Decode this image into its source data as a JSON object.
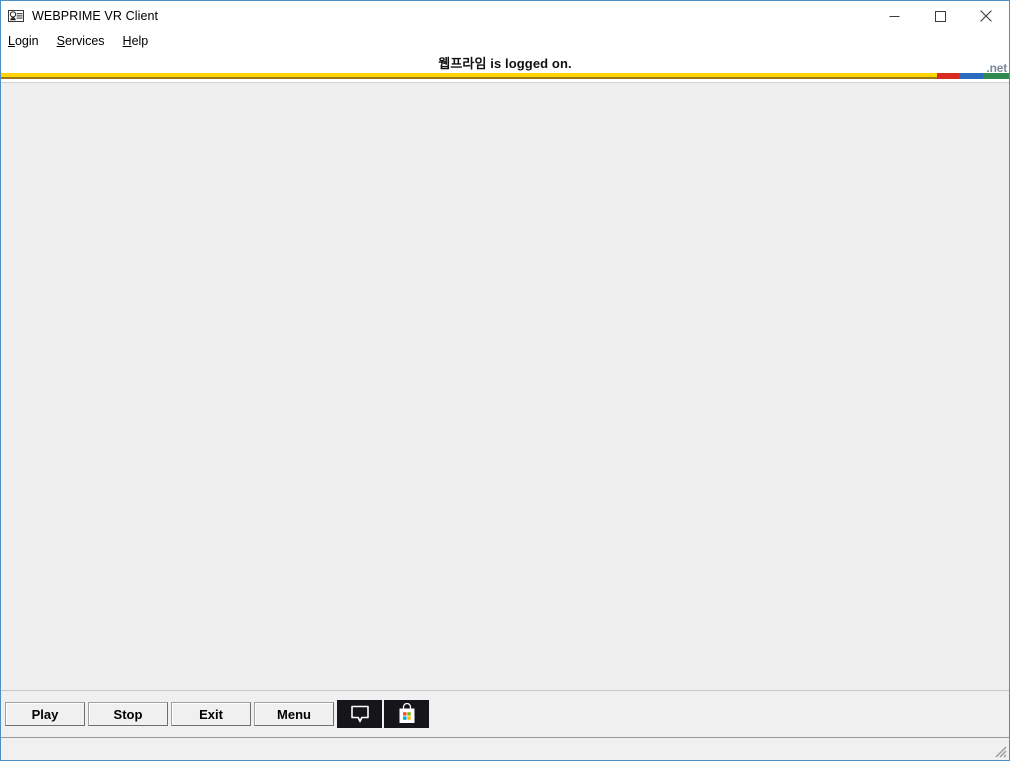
{
  "window": {
    "title": "WEBPRIME VR Client",
    "icon": "id-card-icon",
    "controls": {
      "minimize": "minimize-icon",
      "maximize": "maximize-icon",
      "close": "close-icon"
    }
  },
  "menu": {
    "items": [
      {
        "label": "Login",
        "accel": "L",
        "rest": "ogin"
      },
      {
        "label": "Services",
        "accel": "S",
        "rest": "ervices"
      },
      {
        "label": "Help",
        "accel": "H",
        "rest": "elp"
      }
    ]
  },
  "banner": {
    "status_text": "웹프라임 is logged on.",
    "user_name": "웹프라임",
    "wordmark": ".net"
  },
  "colors": {
    "rule_gold": "#ffd400",
    "rule_gold_shadow": "#9a7a16",
    "dotnet_red": "#d82a20",
    "dotnet_blue": "#2b6bbf",
    "dotnet_green": "#2f8a4f",
    "window_border": "#4a90c4",
    "content_background": "#efefef",
    "icon_button_background": "#16161a"
  },
  "toolbar": {
    "buttons": [
      {
        "label": "Play",
        "name": "play-button"
      },
      {
        "label": "Stop",
        "name": "stop-button"
      },
      {
        "label": "Exit",
        "name": "exit-button"
      },
      {
        "label": "Menu",
        "name": "menu-button"
      }
    ],
    "icon_buttons": [
      {
        "icon": "chat-bubble-icon",
        "name": "chat-button"
      },
      {
        "icon": "microsoft-store-icon",
        "name": "store-button"
      }
    ]
  },
  "status_bar": {
    "text": ""
  },
  "content": {
    "body_text": ""
  }
}
